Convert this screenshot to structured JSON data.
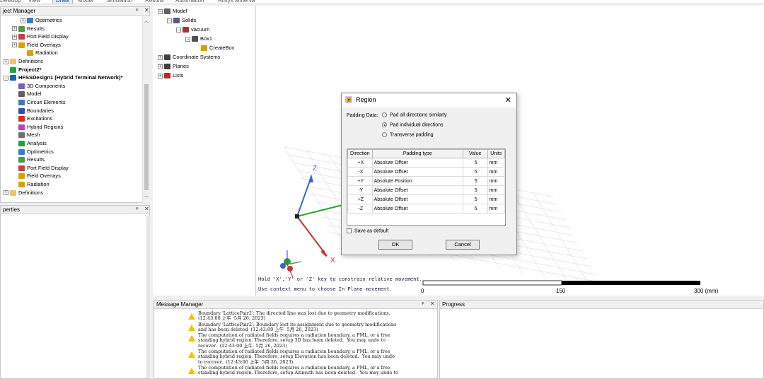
{
  "ribbon": {
    "tabs": [
      "Desktop",
      "View",
      "Draw",
      "Model",
      "Simulation",
      "Results",
      "Automation",
      "Ansys Minerva"
    ]
  },
  "project_manager": {
    "title": "ject Manager",
    "rows": [
      {
        "label": "Optimetrics",
        "indent": 24,
        "exp": "+",
        "icon": "optimetrics-icon"
      },
      {
        "label": "Results",
        "indent": 12,
        "exp": "+",
        "icon": "results-icon"
      },
      {
        "label": "Port Field Display",
        "indent": 12,
        "exp": "+",
        "icon": "port-field-icon"
      },
      {
        "label": "Field Overlays",
        "indent": 12,
        "exp": "+",
        "icon": "field-overlays-icon"
      },
      {
        "label": "Radiation",
        "indent": 24,
        "exp": "",
        "icon": "radiation-icon"
      },
      {
        "label": "Definitions",
        "indent": 0,
        "exp": "+",
        "icon": "folder-icon"
      },
      {
        "label": "Project2*",
        "indent": 0,
        "exp": "",
        "icon": "project-icon",
        "bold": true
      },
      {
        "label": "HFSSDesign1 (Hybrid Terminal Network)*",
        "indent": 0,
        "exp": "-",
        "icon": "hfss-design-icon",
        "bold": true
      },
      {
        "label": "3D Components",
        "indent": 12,
        "exp": "",
        "icon": "components-icon"
      },
      {
        "label": "Model",
        "indent": 12,
        "exp": "",
        "icon": "model-icon"
      },
      {
        "label": "Circuit Elements",
        "indent": 12,
        "exp": "",
        "icon": "circuit-icon"
      },
      {
        "label": "Boundaries",
        "indent": 12,
        "exp": "",
        "icon": "boundaries-icon"
      },
      {
        "label": "Excitations",
        "indent": 12,
        "exp": "",
        "icon": "excitations-icon"
      },
      {
        "label": "Hybrid Regions",
        "indent": 12,
        "exp": "",
        "icon": "hybrid-icon"
      },
      {
        "label": "Mesh",
        "indent": 12,
        "exp": "",
        "icon": "mesh-icon"
      },
      {
        "label": "Analysis",
        "indent": 12,
        "exp": "",
        "icon": "analysis-icon"
      },
      {
        "label": "Optimetrics",
        "indent": 12,
        "exp": "",
        "icon": "optimetrics-icon"
      },
      {
        "label": "Results",
        "indent": 12,
        "exp": "",
        "icon": "results-icon"
      },
      {
        "label": "Port Field Display",
        "indent": 12,
        "exp": "",
        "icon": "port-field-icon"
      },
      {
        "label": "Field Overlays",
        "indent": 12,
        "exp": "",
        "icon": "field-overlays-icon"
      },
      {
        "label": "Radiation",
        "indent": 12,
        "exp": "",
        "icon": "radiation-icon"
      },
      {
        "label": "Definitions",
        "indent": 0,
        "exp": "+",
        "icon": "folder-icon"
      }
    ]
  },
  "properties": {
    "title": "perties"
  },
  "model_tree": {
    "rows": [
      {
        "label": "Model",
        "indent": 0,
        "exp": "-",
        "icon": "model-icon"
      },
      {
        "label": "Solids",
        "indent": 13,
        "exp": "-",
        "icon": "solids-icon"
      },
      {
        "label": "vacuum",
        "indent": 26,
        "exp": "-",
        "icon": "material-icon"
      },
      {
        "label": "Box1",
        "indent": 39,
        "exp": "-",
        "icon": "box-icon"
      },
      {
        "label": "CreateBox",
        "indent": 52,
        "exp": "",
        "icon": "create-box-icon"
      },
      {
        "label": "Coordinate Systems",
        "indent": 0,
        "exp": "+",
        "icon": "coordinate-icon"
      },
      {
        "label": "Planes",
        "indent": 0,
        "exp": "+",
        "icon": "planes-icon"
      },
      {
        "label": "Lists",
        "indent": 0,
        "exp": "+",
        "icon": "lists-icon"
      }
    ]
  },
  "viewport": {
    "hint1": "Hold 'X','Y' or 'Z' key to constrain relative movement.",
    "hint2": "Use context menu to choose In Plane movement.",
    "scale": {
      "t0": "0",
      "t1": "150",
      "t2": "300 (mm)"
    },
    "axes": {
      "x": "X",
      "y": "Y",
      "z": "Z"
    }
  },
  "dialog": {
    "title": "Region",
    "padding_label": "Padding Data:",
    "options": [
      "Pad all directions similarly",
      "Pad individual directions",
      "Transverse padding"
    ],
    "selected_option": 1,
    "columns": [
      "Direction",
      "Padding type",
      "Value",
      "Units"
    ],
    "rows": [
      {
        "dir": "+X",
        "type": "Absolute Offset",
        "value": "5",
        "unit": "mm"
      },
      {
        "dir": "-X",
        "type": "Absolute Offset",
        "value": "5",
        "unit": "mm"
      },
      {
        "dir": "+Y",
        "type": "Absolute Position",
        "value": "5",
        "unit": "mm"
      },
      {
        "dir": "-Y",
        "type": "Absolute Offset",
        "value": "5",
        "unit": "mm"
      },
      {
        "dir": "+Z",
        "type": "Absolute Offset",
        "value": "5",
        "unit": "mm"
      },
      {
        "dir": "-Z",
        "type": "Absolute Offset",
        "value": "5",
        "unit": "mm"
      }
    ],
    "save_default": "Save as default",
    "ok": "OK",
    "cancel": "Cancel"
  },
  "message_manager": {
    "title": "Message Manager",
    "messages": [
      "Boundary 'LatticePair2': The directed line was lost due to geometry modifications.\n(12:43:00 上午  5月 26, 2023)",
      "Boundary 'LatticePair2': Boundary lost its assignment due to geometry modifications\nand has been deleted  (12:43:00 上午  5月 26, 2023)",
      "The computation of radiated fields requires a radiation boundary, a PML, or a free\nstanding hybrid region. Therefore, setup 3D has been deleted.  You may undo to\nrecover.  (12:43:00 上午  5月 26, 2023)",
      "The computation of radiated fields requires a radiation boundary, a PML, or a free\nstanding hybrid region. Therefore, setup Elevation has been deleted.  You may undo\nto recover.  (12:43:00 上午  5月 26, 2023)",
      "The computation of radiated fields requires a radiation boundary, a PML, or a free\nstanding hybrid region. Therefore, setup Azimuth has been deleted.  You may undo to"
    ]
  },
  "progress": {
    "title": "Progress"
  },
  "colors": {
    "accent_blue": "#1f5fbf",
    "axis_red": "#d03030",
    "axis_green": "#2fa030",
    "axis_blue": "#3a64c8",
    "warning": "#f2c200"
  }
}
